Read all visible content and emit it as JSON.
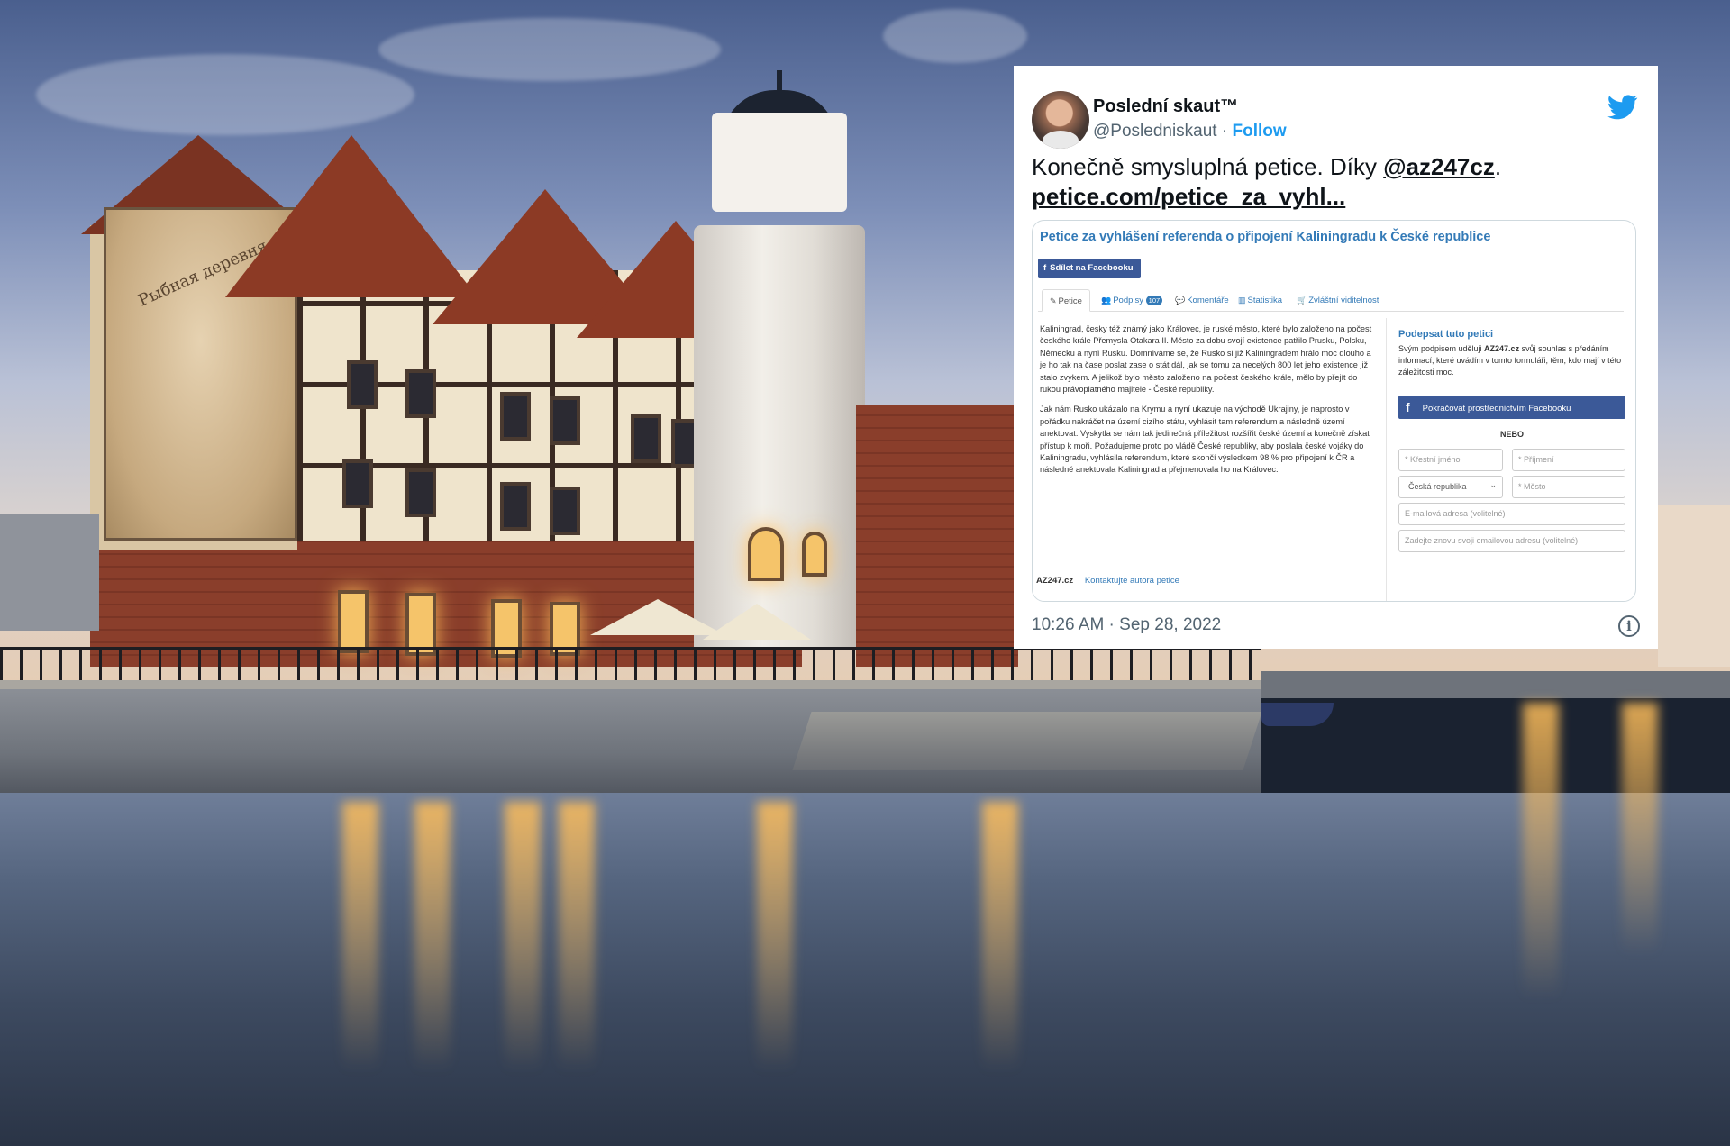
{
  "tweet": {
    "author_name": "Poslední skaut™",
    "handle": "@Posledniskaut",
    "separator": "·",
    "follow_label": "Follow",
    "text_before": "Konečně smysluplná petice. Díky ",
    "mention": "@az247cz",
    "text_after": ".",
    "link": "petice.com/petice_za_vyhl...",
    "timestamp": "10:26 AM · Sep 28, 2022",
    "brand_icon": "twitter-bird-icon",
    "info_icon": "info-icon",
    "brand_color": "#1d9bf0"
  },
  "petition": {
    "title": "Petice za vyhlášení referenda o připojení Kaliningradu k České republice",
    "share_label": "Sdílet na Facebooku",
    "tabs": [
      {
        "label": "Petice",
        "icon": "pencil-icon"
      },
      {
        "label": "Podpisy",
        "icon": "users-icon",
        "badge": "107"
      },
      {
        "label": "Komentáře",
        "icon": "comments-icon"
      },
      {
        "label": "Statistika",
        "icon": "bar-chart-icon"
      },
      {
        "label": "Zvláštní viditelnost",
        "icon": "cart-icon"
      }
    ],
    "paragraph_1": "Kaliningrad, česky též známý jako Královec, je ruské město, které bylo založeno na počest českého krále Přemysla Otakara II. Město za dobu svojí existence patřilo Prusku, Polsku, Německu a nyní Rusku. Domníváme se, že Rusko si již Kaliningradem hrálo moc dlouho a je ho tak na čase poslat zase o stát dál, jak se tomu za necelých 800 let jeho existence již stalo zvykem. A jelikož bylo město založeno na počest českého krále, mělo by přejít do rukou právoplatného majitele - České republiky.",
    "paragraph_2": "Jak nám Rusko ukázalo na Krymu a nyní ukazuje na východě Ukrajiny, je naprosto v pořádku nakráčet na území cizího státu, vyhlásit tam referendum a následně území anektovat. Vyskytla se nám tak jedinečná příležitost rozšířit české území a konečně získat přístup k moři. Požadujeme proto po vládě České republiky, aby poslala české vojáky do Kaliningradu, vyhlásila referendum, které skončí výsledkem 98 % pro připojení k ČR a následně anektovala Kaliningrad a přejmenovala ho na Královec.",
    "footer_brand": "AZ247.cz",
    "footer_link": "Kontaktujte autora petice",
    "sign_title": "Podepsat tuto petici",
    "sign_desc_before": "Svým podpisem uděluji ",
    "sign_desc_brand": "AZ247.cz",
    "sign_desc_after": " svůj souhlas s předáním informací, které uvádím v tomto formuláři, těm, kdo mají v této záležitosti moc.",
    "fb_continue_label": "Pokračovat prostřednictvím Facebooku",
    "or_label": "NEBO",
    "fields": {
      "first_name_placeholder": "* Křestní jméno",
      "last_name_placeholder": "* Příjmení",
      "country_value": "Česká republika",
      "city_placeholder": "* Město",
      "email_placeholder": "E-mailová adresa (volitelné)",
      "email_repeat_placeholder": "Zadejte znovu svoji emailovou adresu (volitelné)"
    },
    "link_color": "#337ab7",
    "facebook_color": "#3b5998"
  },
  "background": {
    "mural_text": "Рыбная деревня"
  }
}
